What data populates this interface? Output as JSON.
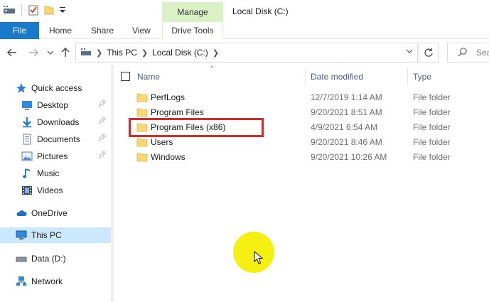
{
  "ribbon": {
    "contextual_group": "Manage",
    "window_title": "Local Disk (C:)",
    "tabs": [
      "File",
      "Home",
      "Share",
      "View",
      "Drive Tools"
    ]
  },
  "navigation": {
    "breadcrumb": [
      "This PC",
      "Local Disk (C:)"
    ],
    "search_placeholder": "Sea"
  },
  "sidebar": {
    "items": [
      {
        "label": "Quick access",
        "icon": "star-icon",
        "pinned": false
      },
      {
        "label": "Desktop",
        "icon": "desktop-icon",
        "pinned": true
      },
      {
        "label": "Downloads",
        "icon": "download-icon",
        "pinned": true
      },
      {
        "label": "Documents",
        "icon": "documents-icon",
        "pinned": true
      },
      {
        "label": "Pictures",
        "icon": "pictures-icon",
        "pinned": true
      },
      {
        "label": "Music",
        "icon": "music-icon",
        "pinned": false
      },
      {
        "label": "Videos",
        "icon": "videos-icon",
        "pinned": false
      },
      {
        "label": "OneDrive",
        "icon": "cloud-icon",
        "pinned": false
      },
      {
        "label": "This PC",
        "icon": "computer-icon",
        "pinned": false,
        "selected": true
      },
      {
        "label": "Data (D:)",
        "icon": "drive-icon",
        "pinned": false
      },
      {
        "label": "Network",
        "icon": "network-icon",
        "pinned": false
      }
    ]
  },
  "filelist": {
    "columns": {
      "name": "Name",
      "date": "Date modified",
      "type": "Type"
    },
    "rows": [
      {
        "name": "PerfLogs",
        "date": "12/7/2019 1:14 AM",
        "type": "File folder"
      },
      {
        "name": "Program Files",
        "date": "9/20/2021 8:51 AM",
        "type": "File folder"
      },
      {
        "name": "Program Files (x86)",
        "date": "4/9/2021 6:54 AM",
        "type": "File folder",
        "highlighted": true
      },
      {
        "name": "Users",
        "date": "9/20/2021 8:46 AM",
        "type": "File folder"
      },
      {
        "name": "Windows",
        "date": "9/20/2021 10:26 AM",
        "type": "File folder"
      }
    ]
  },
  "colors": {
    "file_tab": "#1979ca",
    "manage_tab": "#d9f1c4",
    "selected_item": "#cce8ff",
    "highlight_box": "#d62a2a",
    "cursor_spot": "#f5ef12",
    "folder": "#f8d775"
  }
}
